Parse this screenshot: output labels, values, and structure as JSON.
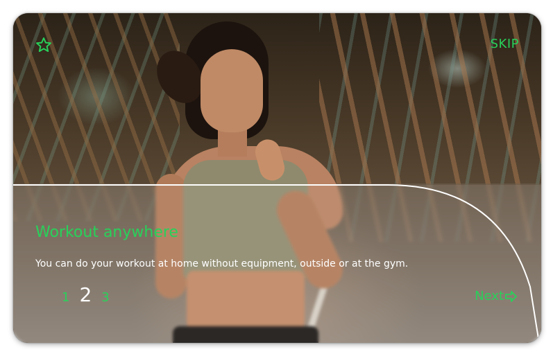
{
  "header": {
    "star_icon": "star-outline-icon",
    "skip_label": "SKIP"
  },
  "slide": {
    "title": "Workout anywhere",
    "description": "You can do your workout at home without equipment, outside or at the gym."
  },
  "pager": {
    "pages": [
      "1",
      "2",
      "3"
    ],
    "active_index": 1
  },
  "footer": {
    "next_label": "Next",
    "next_icon": "arrow-right-outline-icon"
  },
  "colors": {
    "accent": "#28d15a",
    "text_light": "#ffffff",
    "panel_outline": "#ffffff"
  }
}
